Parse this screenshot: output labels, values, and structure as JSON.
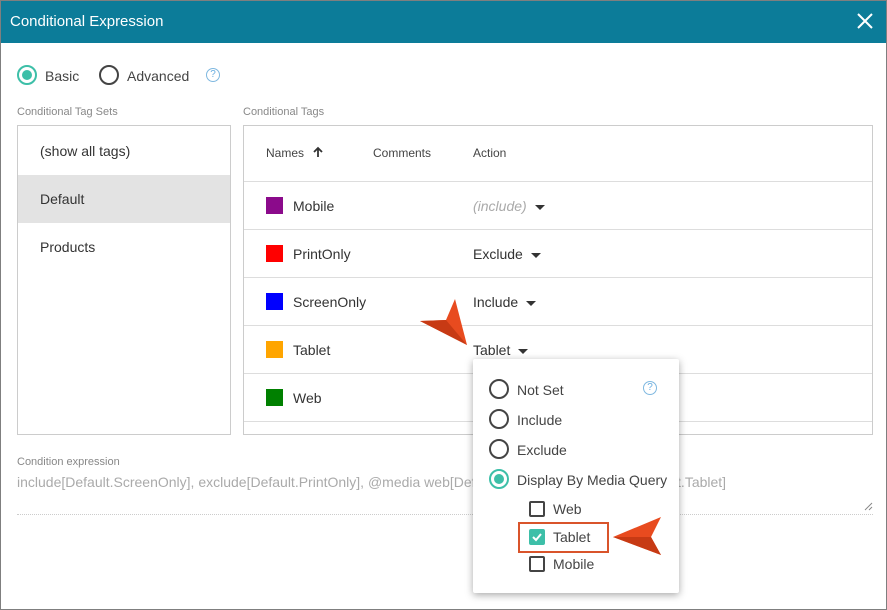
{
  "dialog": {
    "title": "Conditional Expression",
    "close_icon": "close-icon"
  },
  "mode": {
    "basic_label": "Basic",
    "advanced_label": "Advanced",
    "selected": "Basic",
    "help_icon": "help-icon"
  },
  "tag_sets": {
    "title": "Conditional Tag Sets",
    "items": [
      {
        "label": "(show all tags)",
        "selected": false
      },
      {
        "label": "Default",
        "selected": true
      },
      {
        "label": "Products",
        "selected": false
      }
    ]
  },
  "tags": {
    "title": "Conditional Tags",
    "columns": {
      "names": "Names",
      "comments": "Comments",
      "action": "Action"
    },
    "sort_icon": "arrow-up-icon",
    "rows": [
      {
        "name": "Mobile",
        "color": "#8b0a8b",
        "action": "(include)",
        "placeholder": true
      },
      {
        "name": "PrintOnly",
        "color": "#ff0000",
        "action": "Exclude",
        "placeholder": false
      },
      {
        "name": "ScreenOnly",
        "color": "#0000ff",
        "action": "Include",
        "placeholder": false
      },
      {
        "name": "Tablet",
        "color": "#ffa500",
        "action": "Tablet",
        "placeholder": false
      },
      {
        "name": "Web",
        "color": "#008000",
        "action": "",
        "placeholder": false
      }
    ]
  },
  "dropdown": {
    "options": [
      {
        "label": "Not Set",
        "checked": false
      },
      {
        "label": "Include",
        "checked": false
      },
      {
        "label": "Exclude",
        "checked": false
      },
      {
        "label": "Display By Media Query",
        "checked": true
      }
    ],
    "media": [
      {
        "label": "Web",
        "checked": false
      },
      {
        "label": "Tablet",
        "checked": true
      },
      {
        "label": "Mobile",
        "checked": false
      }
    ]
  },
  "expression": {
    "label": "Condition expression",
    "value": "include[Default.ScreenOnly], exclude[Default.PrintOnly], @media web[Default.Web], @media tablet[Default.Tablet]"
  },
  "colors": {
    "accent": "#3dbfa8",
    "titlebar": "#0c7c99",
    "callout": "#e84b1f"
  }
}
